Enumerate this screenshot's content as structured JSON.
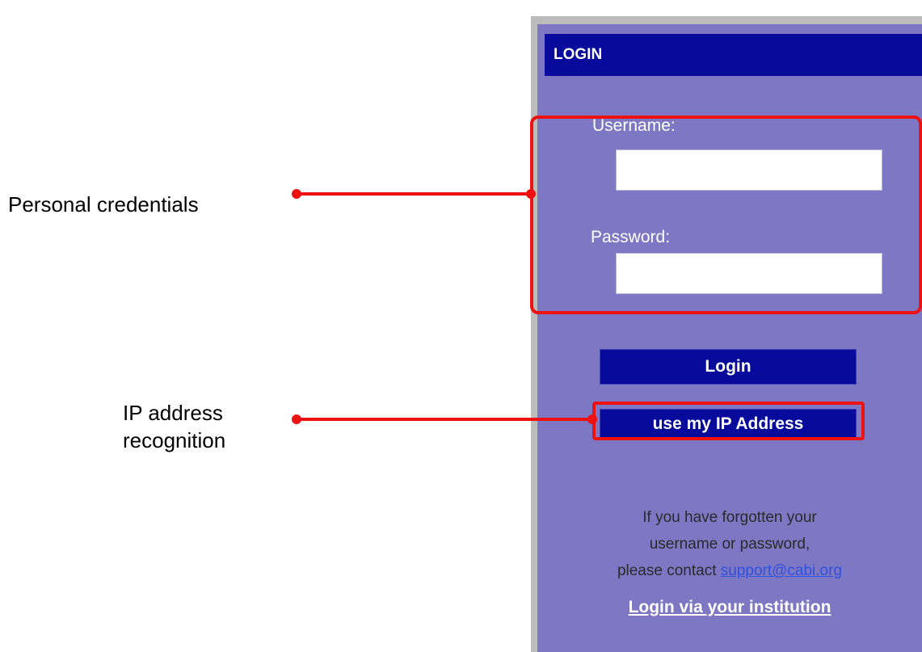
{
  "annotations": {
    "personal_credentials": "Personal credentials",
    "ip_line1": "IP address",
    "ip_line2": "recognition"
  },
  "login_panel": {
    "header_title": "LOGIN",
    "username_label": "Username:",
    "username_value": "",
    "password_label": "Password:",
    "password_value": "",
    "login_button": "Login",
    "ip_button": "use my IP Address",
    "help_line1": "If you have forgotten your",
    "help_line2": "username or password,",
    "help_line3_prefix": "please contact ",
    "help_email": "support@cabi.org",
    "institution_link": "Login via your institution"
  },
  "colors": {
    "panel_bg": "#7d77c4",
    "header_bg": "#070a9a",
    "button_bg": "#070a9a",
    "highlight": "#ee1111",
    "link": "#3050e0"
  }
}
